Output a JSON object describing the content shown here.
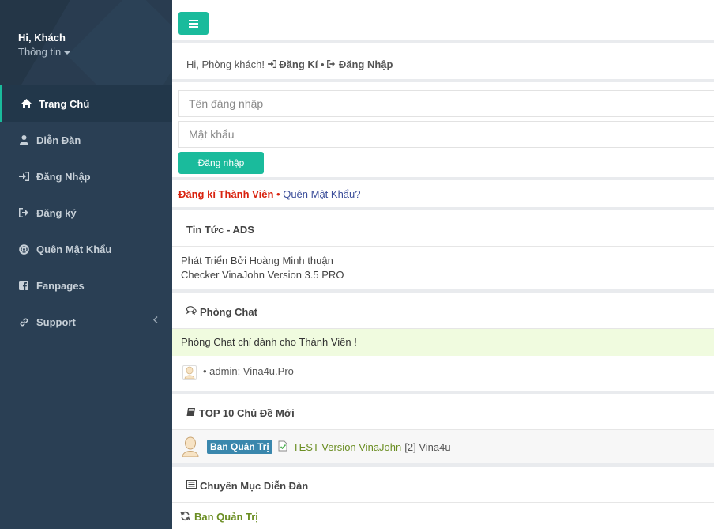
{
  "sidebar": {
    "greeting": "Hi, Khách",
    "info_label": "Thông tin",
    "items": [
      {
        "label": "Trang Chủ",
        "icon": "home-icon"
      },
      {
        "label": "Diễn Đàn",
        "icon": "user-icon"
      },
      {
        "label": "Đăng Nhập",
        "icon": "sign-in-icon"
      },
      {
        "label": "Đăng ký",
        "icon": "sign-out-icon"
      },
      {
        "label": "Quên Mật Khẩu",
        "icon": "life-ring-icon"
      },
      {
        "label": "Fanpages",
        "icon": "facebook-icon"
      },
      {
        "label": "Support",
        "icon": "link-icon"
      }
    ]
  },
  "welcome": {
    "prefix": "Hi, Phòng khách!",
    "register": "Đăng Kí",
    "separator": "•",
    "login": "Đăng Nhập"
  },
  "login_form": {
    "username_placeholder": "Tên đăng nhập",
    "password_placeholder": "Mật khẩu",
    "submit_label": "Đăng nhập"
  },
  "register_line": {
    "register_link": "Đăng kí Thành Viên",
    "separator": "•",
    "forgot_link": "Quên Mật Khẩu?"
  },
  "news": {
    "title": "Tin Tức - ADS",
    "lines": [
      "Phát Triển Bởi Hoàng Minh thuận",
      "Checker VinaJohn Version 3.5 PRO"
    ]
  },
  "chat": {
    "title": "Phòng Chat",
    "notice": "Phòng Chat chỉ dành cho Thành Viên !",
    "message": "• admin: Vina4u.Pro"
  },
  "top10": {
    "title": "TOP 10 Chủ Đề Mới",
    "topics": [
      {
        "badge": "Ban Quản Trị",
        "title": "TEST Version VinaJohn",
        "meta": "[2] Vina4u"
      }
    ]
  },
  "categories": {
    "title": "Chuyên Mục Diễn Đàn",
    "items": [
      {
        "label": "Ban Quản Trị"
      }
    ]
  },
  "colors": {
    "sidebar_bg": "#2a3f54",
    "accent": "#1abb9c",
    "register_red": "#d9230f",
    "chat_notice_bg": "#f0fbdf",
    "badge_blue": "#3a87ad",
    "topic_green": "#6b8e23"
  }
}
